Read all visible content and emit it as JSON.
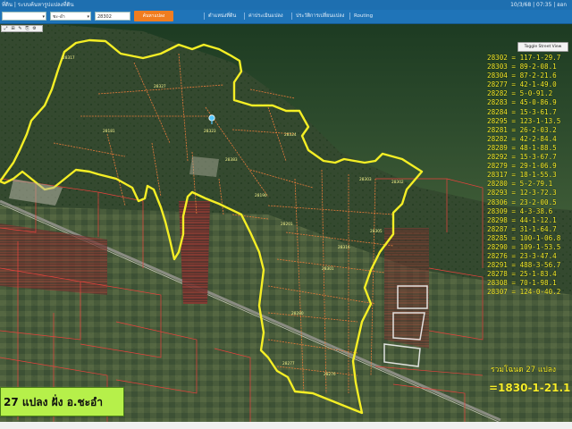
{
  "header": {
    "title": "ที่ดิน | ระบบค้นหารูปแปลงที่ดิน",
    "right_text": "10/3/68 | 07:35 | ออก"
  },
  "toolbar": {
    "province_value": "",
    "district_value": "ชะ-อำ",
    "parcel_value": "28302",
    "search_label": "ค้นหาแปลง",
    "nav_links": [
      "ตำแหน่งที่ดิน",
      "ค่าประเมินแปลง",
      "ประวัติการเปลี่ยนแปลง",
      "Routing"
    ],
    "mini_tools": [
      "⤢",
      "⊞",
      "✎",
      "⎘",
      "⚙"
    ]
  },
  "map": {
    "toggle_label": "Toggle Street View",
    "parcel_labels": [
      "28317",
      "28327",
      "28181",
      "28323",
      "28383",
      "28324",
      "28190",
      "28201",
      "28316",
      "28303",
      "28305",
      "28302",
      "28301",
      "28280",
      "28277",
      "28276"
    ],
    "colors": {
      "boundary": "#f4ee25",
      "parcel_lines": "#e87a3a",
      "cadastral": "#e8423c",
      "label_text": "#f6ee2a"
    }
  },
  "parcels": [
    "28302 = 117-1-29.7",
    "28303 = 89-2-08.1",
    "28304 = 87-2-21.6",
    "28277 = 42-1-49.0",
    "28282 = 5-0-91.2",
    "28283 = 45-0-86.9",
    "28284 = 15-3-61.7",
    "28295 = 123-1-13.5",
    "28281 = 26-2-03.2",
    "28282 = 42-2-84.4",
    "28289 = 48-1-88.5",
    "28292 = 15-3-67.7",
    "28279 = 29-1-06.9",
    "28317 = 18-1-55.3",
    "28280 = 5-2-79.1",
    "28293 = 12-3-72.3",
    "28306 = 23-2-00.5",
    "28309 = 4-3-38.6",
    "28298 = 44-1-12.1",
    "28287 = 31-1-64.7",
    "28285 = 100-1-06.8",
    "28290 = 109-1-53.5",
    "28276 = 23-3-47.4",
    "28291 = 488-3-56.7",
    "28278 = 25-1-83.4",
    "28308 = 70-1-98.1",
    "28307 = 124-0-40.2"
  ],
  "total_label": "รวมโฉนด 27 แปลง",
  "total_value": "=1830-1-21.1",
  "caption": "27 แปลง ฝั่ง อ.ชะอำ"
}
